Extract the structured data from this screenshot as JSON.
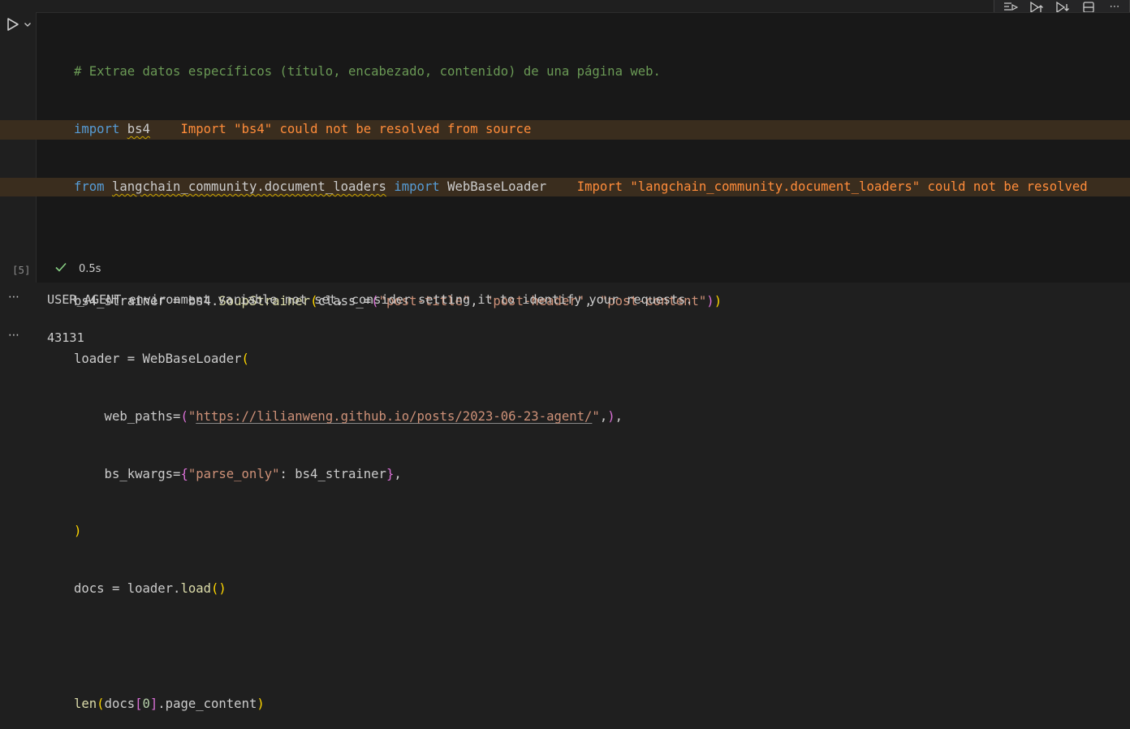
{
  "toolbar": {
    "icons": [
      "run-by-line-icon",
      "execute-above-icon",
      "execute-below-icon",
      "split-cell-icon",
      "more-actions-icon"
    ],
    "more_label": "⋯"
  },
  "cell": {
    "execution_count": "[5]",
    "status_time": "0.5s",
    "code": {
      "comment": "# Extrae datos específicos (título, encabezado, contenido) de una página web.",
      "import_kw": "import",
      "bs4": "bs4",
      "warn_bs4": "Import \"bs4\" could not be resolved from source",
      "from_kw": "from",
      "lc_module": "langchain_community.document_loaders",
      "import_kw2": "import",
      "web_loader": "WebBaseLoader",
      "warn_lc": "Import \"langchain_community.document_loaders\" could not be resolved",
      "l4_a": "bs4_strainer = bs4.",
      "l4_fn": "SoupStrainer",
      "l4_p1": "(",
      "l4_b": "class_=",
      "l4_p2": "(",
      "l4_s1": "\"post-title\"",
      "l4_c1": ", ",
      "l4_s2": "\"post-header\"",
      "l4_c2": ", ",
      "l4_s3": "\"post-content\"",
      "l4_p3": ")",
      "l4_p4": ")",
      "l5_a": "loader = WebBaseLoader",
      "l5_p": "(",
      "l6_a": "    web_paths=",
      "l6_p": "(",
      "l6_q1": "\"",
      "l6_url": "https://lilianweng.github.io/posts/2023-06-23-agent/",
      "l6_q2": "\"",
      "l6_c": ",",
      "l6_p2": ")",
      "l6_end": ",",
      "l7_a": "    bs_kwargs=",
      "l7_b": "{",
      "l7_s": "\"parse_only\"",
      "l7_c": ": bs4_strainer",
      "l7_b2": "}",
      "l7_end": ",",
      "l8_p": ")",
      "l9_a": "docs = loader.",
      "l9_fn": "load",
      "l9_p": "()",
      "l11_fn": "len",
      "l11_p1": "(",
      "l11_a": "docs",
      "l11_b1": "[",
      "l11_n": "0",
      "l11_b2": "]",
      "l11_b": ".page_content",
      "l11_p2": ")"
    }
  },
  "outputs": {
    "dots": "⋯",
    "stderr": "USER_AGENT environment variable not set, consider setting it to identify your requests.",
    "result": "43131"
  }
}
